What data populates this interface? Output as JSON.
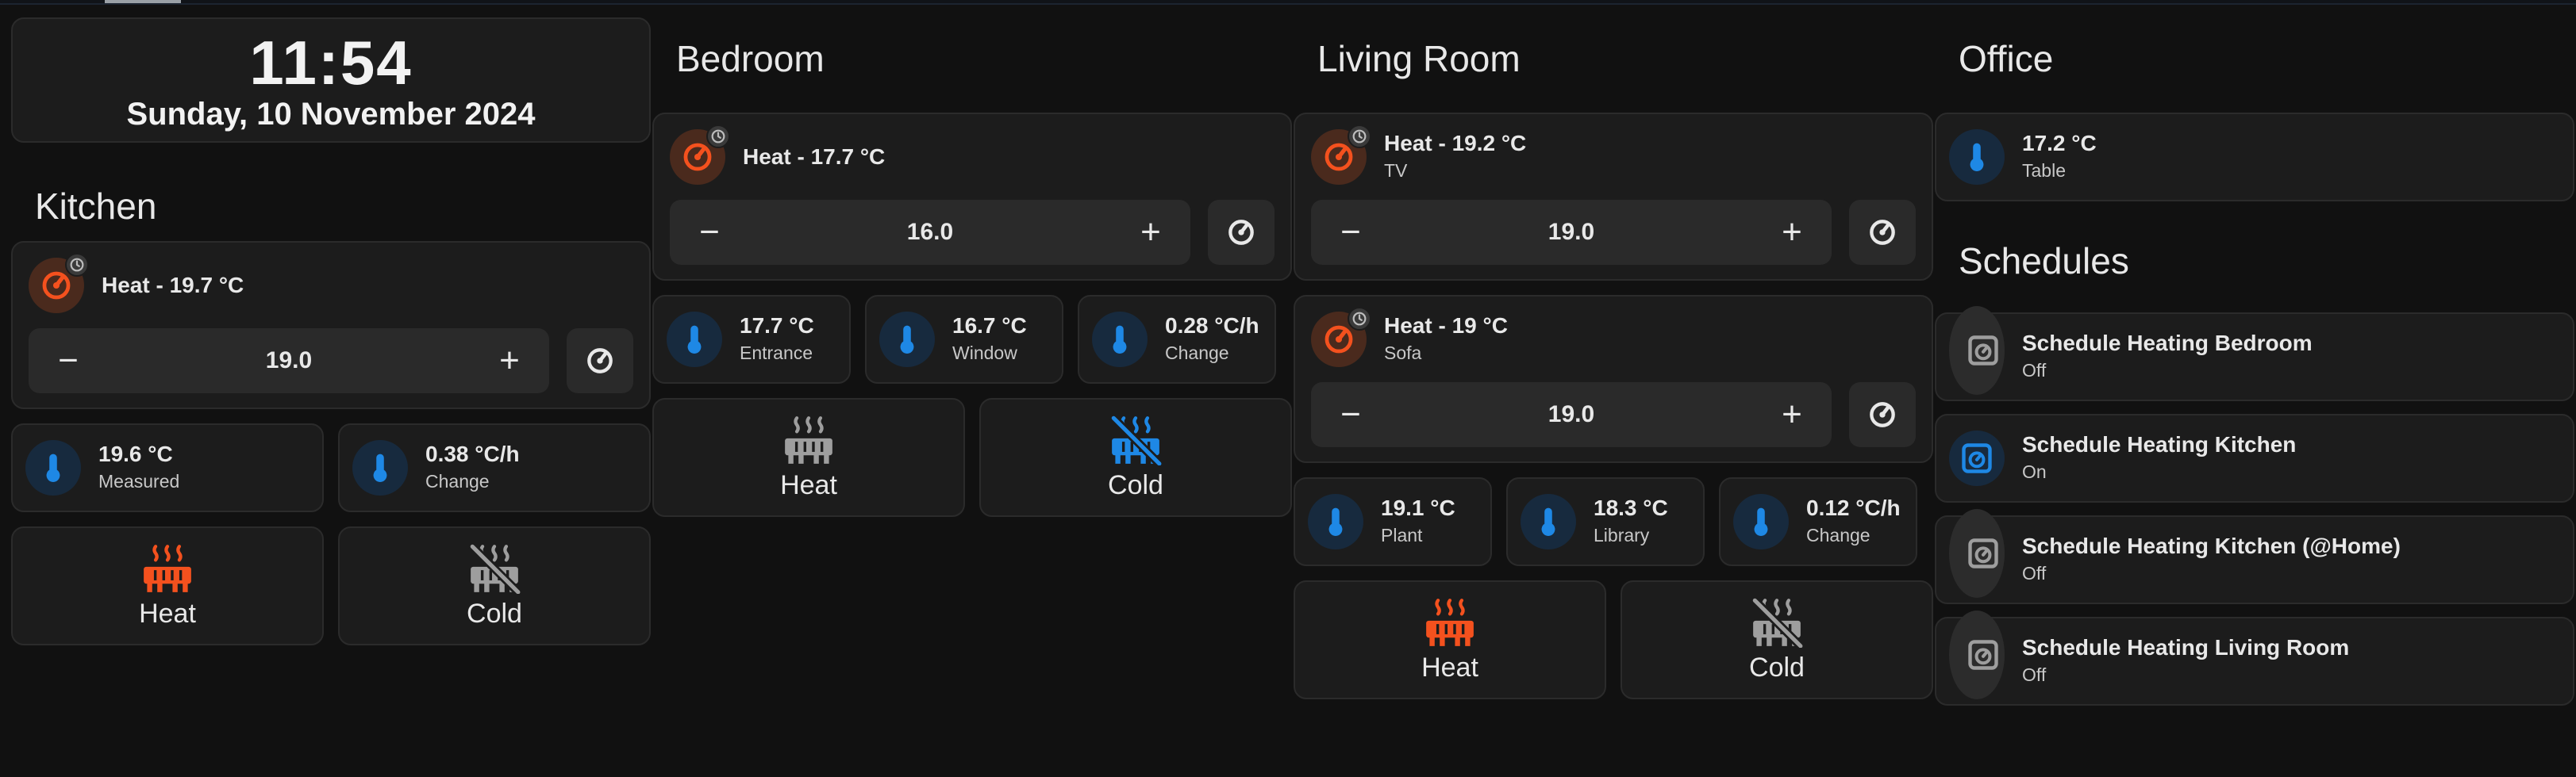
{
  "clock": {
    "time": "11:54",
    "date": "Sunday, 10 November 2024"
  },
  "colors": {
    "heat": "#f4511e",
    "cold": "#1e88e5",
    "off": "#9e9e9e",
    "background": "#111111",
    "card": "#1c1c1c"
  },
  "controls": {
    "minus": "−",
    "plus": "+"
  },
  "kitchen": {
    "title": "Kitchen",
    "thermostat": {
      "primary": "Heat - 19.7 °C",
      "setpoint": "19.0"
    },
    "sensors": [
      {
        "value": "19.6 °C",
        "name": "Measured"
      },
      {
        "value": "0.38 °C/h",
        "name": "Change"
      }
    ],
    "heat_label": "Heat",
    "cold_label": "Cold"
  },
  "bedroom": {
    "title": "Bedroom",
    "thermostat": {
      "primary": "Heat - 17.7 °C",
      "setpoint": "16.0"
    },
    "sensors": [
      {
        "value": "17.7 °C",
        "name": "Entrance"
      },
      {
        "value": "16.7 °C",
        "name": "Window"
      },
      {
        "value": "0.28 °C/h",
        "name": "Change"
      }
    ],
    "heat_label": "Heat",
    "cold_label": "Cold"
  },
  "living_room": {
    "title": "Living Room",
    "thermostats": [
      {
        "primary": "Heat - 19.2 °C",
        "secondary": "TV",
        "setpoint": "19.0"
      },
      {
        "primary": "Heat - 19 °C",
        "secondary": "Sofa",
        "setpoint": "19.0"
      }
    ],
    "sensors": [
      {
        "value": "19.1 °C",
        "name": "Plant"
      },
      {
        "value": "18.3 °C",
        "name": "Library"
      },
      {
        "value": "0.12 °C/h",
        "name": "Change"
      }
    ],
    "heat_label": "Heat",
    "cold_label": "Cold"
  },
  "office": {
    "title": "Office",
    "sensor": {
      "value": "17.2 °C",
      "name": "Table"
    }
  },
  "schedules": {
    "title": "Schedules",
    "items": [
      {
        "name": "Schedule Heating Bedroom",
        "state": "Off"
      },
      {
        "name": "Schedule Heating Kitchen",
        "state": "On"
      },
      {
        "name": "Schedule Heating Kitchen (@Home)",
        "state": "Off"
      },
      {
        "name": "Schedule Heating Living Room",
        "state": "Off"
      }
    ]
  }
}
